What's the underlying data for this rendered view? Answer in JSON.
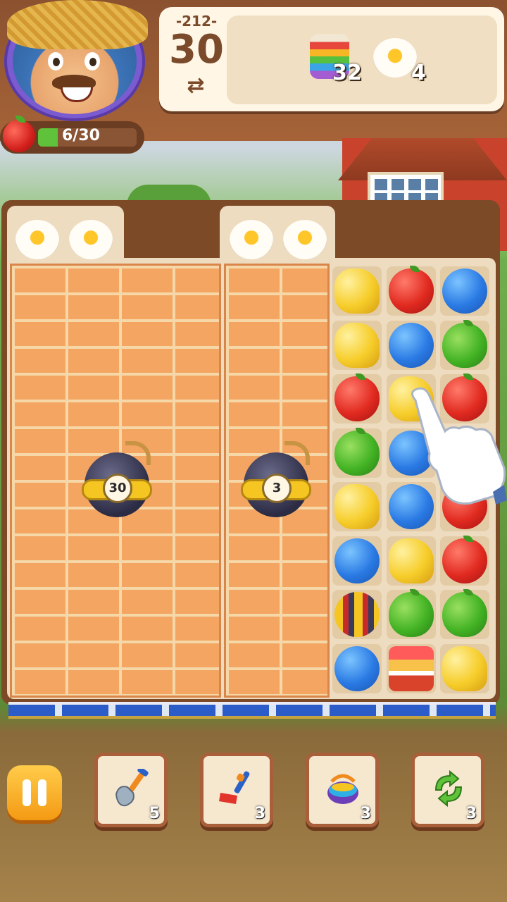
{
  "header": {
    "level": "-212-",
    "moves": "30",
    "swap_icon": "⇄",
    "progress_text": "6/30",
    "progress_fraction": 0.2,
    "goals": [
      {
        "icon": "rainbow-cake-icon",
        "count": "32"
      },
      {
        "icon": "fried-egg-icon",
        "count": "4"
      }
    ]
  },
  "board": {
    "bombs": [
      {
        "count": "30"
      },
      {
        "count": "3"
      }
    ],
    "grid": [
      [
        "cheese",
        "apple",
        "blueberry"
      ],
      [
        "cheese",
        "blueberry",
        "pear"
      ],
      [
        "apple",
        "cheese",
        "apple"
      ],
      [
        "pear",
        "blueberry",
        "apple"
      ],
      [
        "cheese",
        "blueberry",
        "apple"
      ],
      [
        "blueberry",
        "cheese",
        "apple"
      ],
      [
        "striped-egg",
        "pear",
        "pear"
      ],
      [
        "blueberry",
        "gift",
        "cheese"
      ]
    ]
  },
  "boosters": [
    {
      "icon": "shovel-icon",
      "count": "5"
    },
    {
      "icon": "rake-icon",
      "count": "3"
    },
    {
      "icon": "watering-can-icon",
      "count": "3"
    },
    {
      "icon": "shuffle-icon",
      "count": "3"
    }
  ],
  "colors": {
    "accent": "#f49a14",
    "wall": "#f3a561",
    "frame": "#7d4a28"
  }
}
